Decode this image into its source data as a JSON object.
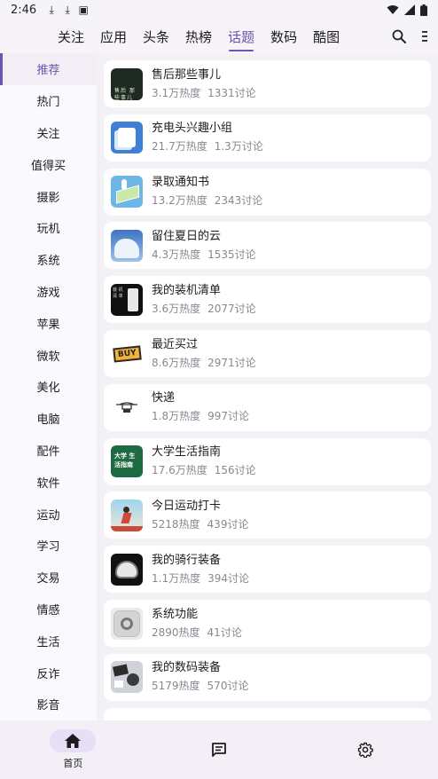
{
  "status_bar": {
    "time": "2:46"
  },
  "tabs": [
    "关注",
    "应用",
    "头条",
    "热榜",
    "话题",
    "数码",
    "酷图"
  ],
  "sidebar": [
    "推荐",
    "热门",
    "关注",
    "值得买",
    "摄影",
    "玩机",
    "系统",
    "游戏",
    "苹果",
    "微软",
    "美化",
    "电脑",
    "配件",
    "软件",
    "运动",
    "学习",
    "交易",
    "情感",
    "生活",
    "反诈",
    "影音"
  ],
  "topics": [
    {
      "title": "售后那些事儿",
      "heat": "3.1万热度",
      "discuss": "1331讨论",
      "icon": "after-sales-icon",
      "thumb_text": "售后 那些事儿"
    },
    {
      "title": "充电头兴趣小组",
      "heat": "21.7万热度",
      "discuss": "1.3万讨论",
      "icon": "charger-icon"
    },
    {
      "title": "录取通知书",
      "heat": "13.2万热度",
      "discuss": "2343讨论",
      "icon": "admission-letter-icon"
    },
    {
      "title": "留住夏日的云",
      "heat": "4.3万热度",
      "discuss": "1535讨论",
      "icon": "cloud-icon"
    },
    {
      "title": "我的装机清单",
      "heat": "3.6万热度",
      "discuss": "2077讨论",
      "icon": "pc-build-icon"
    },
    {
      "title": "最近买过",
      "heat": "8.6万热度",
      "discuss": "2971讨论",
      "icon": "buy-icon",
      "thumb_text": "BUY"
    },
    {
      "title": "快递",
      "heat": "1.8万热度",
      "discuss": "997讨论",
      "icon": "delivery-drone-icon"
    },
    {
      "title": "大学生活指南",
      "heat": "17.6万热度",
      "discuss": "156讨论",
      "icon": "college-guide-icon",
      "thumb_text": "大学 生活指南"
    },
    {
      "title": "今日运动打卡",
      "heat": "5218热度",
      "discuss": "439讨论",
      "icon": "running-icon"
    },
    {
      "title": "我的骑行装备",
      "heat": "1.1万热度",
      "discuss": "394讨论",
      "icon": "helmet-icon"
    },
    {
      "title": "系统功能",
      "heat": "2890热度",
      "discuss": "41讨论",
      "icon": "settings-gear-icon"
    },
    {
      "title": "我的数码装备",
      "heat": "5179热度",
      "discuss": "570讨论",
      "icon": "digital-gear-icon"
    }
  ],
  "bottom_nav": {
    "home_label": "首页"
  },
  "colors": {
    "accent": "#6a55b0",
    "background": "#f3f1f6",
    "card": "#ffffff"
  }
}
